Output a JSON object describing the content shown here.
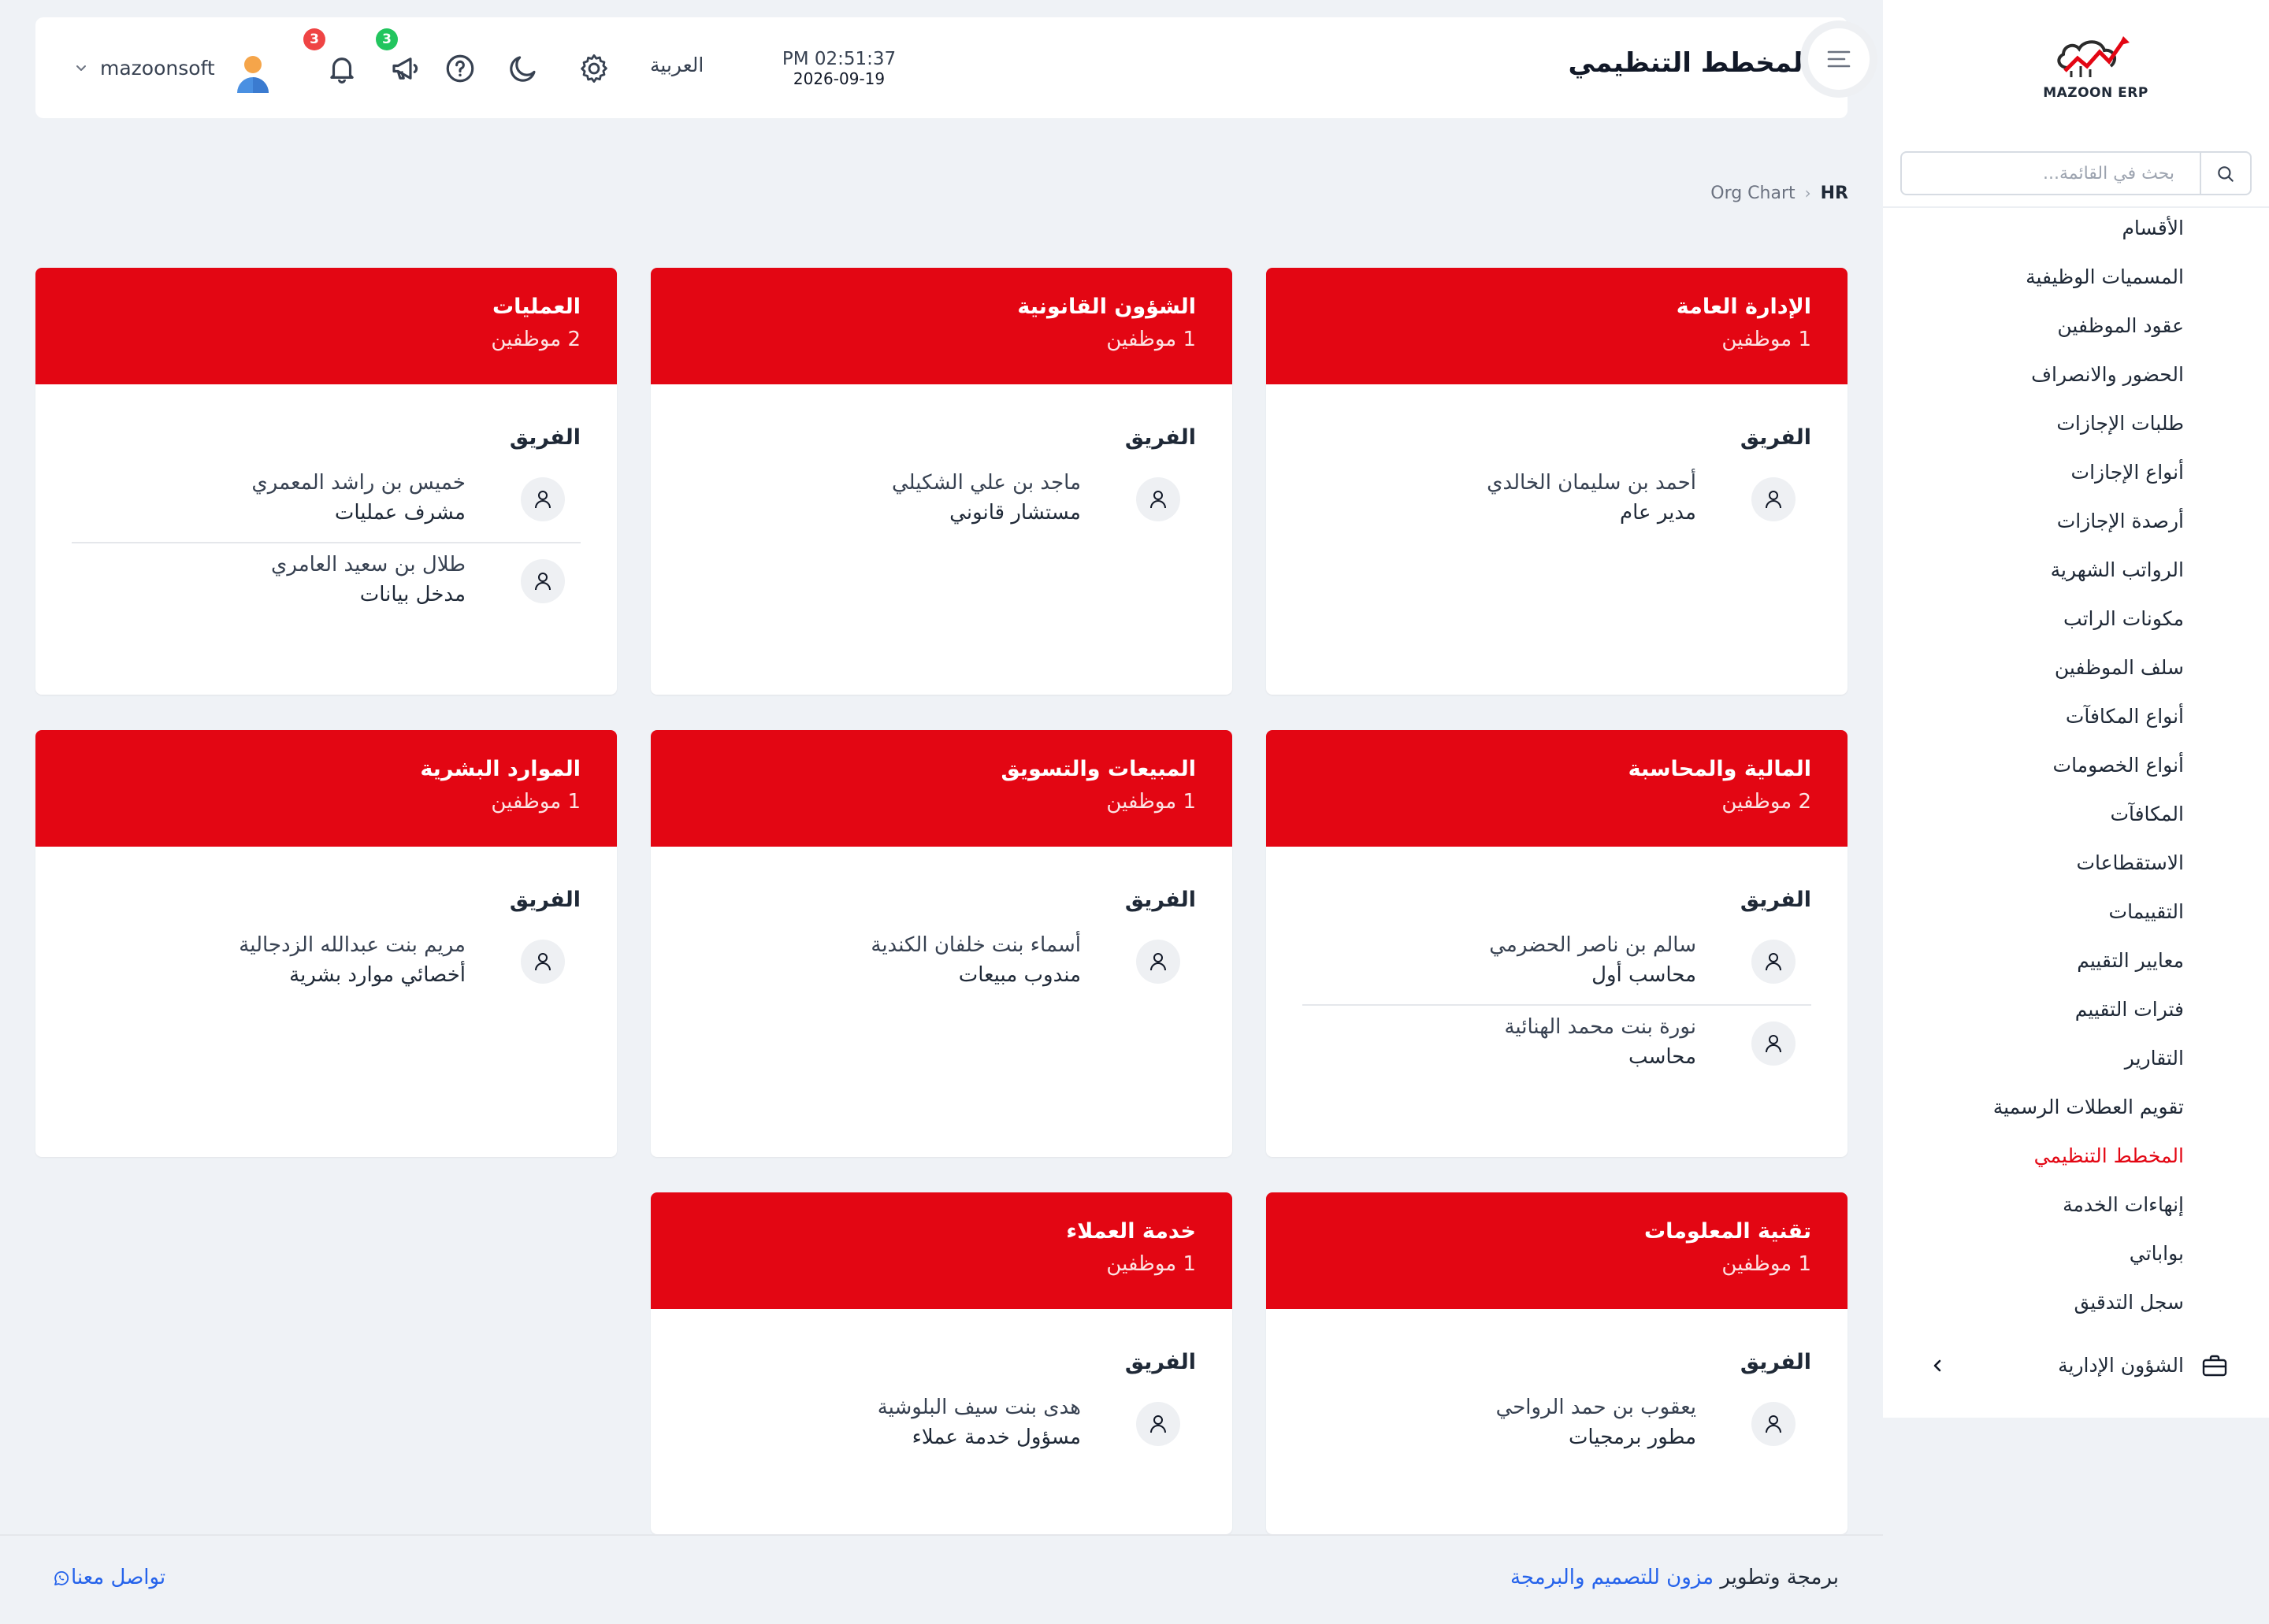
{
  "brand": {
    "logo_text": "MAZOON ERP",
    "accent_color": "#e30613"
  },
  "sidebar": {
    "search_placeholder": "بحث في القائمة...",
    "items": [
      "الأقسام",
      "المسميات الوظيفية",
      "عقود الموظفين",
      "الحضور والانصراف",
      "طلبات الإجازات",
      "أنواع الإجازات",
      "أرصدة الإجازات",
      "الرواتب الشهرية",
      "مكونات الراتب",
      "سلف الموظفين",
      "أنواع المكافآت",
      "أنواع الخصومات",
      "المكافآت",
      "الاستقطاعات",
      "التقييمات",
      "معايير التقييم",
      "فترات التقييم",
      "التقارير",
      "تقويم العطلات الرسمية",
      "المخطط التنظيمي",
      "إنهاءات الخدمة",
      "بواباتي",
      "سجل التدقيق"
    ],
    "active_item": "المخطط التنظيمي",
    "group_label": "الشؤون الإدارية"
  },
  "header": {
    "title": "المخطط التنظيمي",
    "time": "PM 02:51:37",
    "date": "2026-09-19",
    "language": "العربية",
    "notifications_count": "3",
    "announcements_count": "3",
    "username": "mazoonsoft"
  },
  "breadcrumb": {
    "root": "HR",
    "current": "Org Chart"
  },
  "team_label": "الفريق",
  "departments": [
    {
      "name": "الإدارة العامة",
      "count": "1 موظفين",
      "employees": [
        {
          "name": "أحمد بن سليمان الخالدي",
          "role": "مدير عام"
        }
      ]
    },
    {
      "name": "الشؤون القانونية",
      "count": "1 موظفين",
      "employees": [
        {
          "name": "ماجد بن علي الشكيلي",
          "role": "مستشار قانوني"
        }
      ]
    },
    {
      "name": "العمليات",
      "count": "2 موظفين",
      "employees": [
        {
          "name": "خميس بن راشد المعمري",
          "role": "مشرف عمليات"
        },
        {
          "name": "طلال بن سعيد العامري",
          "role": "مدخل بيانات"
        }
      ]
    },
    {
      "name": "المالية والمحاسبة",
      "count": "2 موظفين",
      "employees": [
        {
          "name": "سالم بن ناصر الحضرمي",
          "role": "محاسب أول"
        },
        {
          "name": "نورة بنت محمد الهنائية",
          "role": "محاسب"
        }
      ]
    },
    {
      "name": "المبيعات والتسويق",
      "count": "1 موظفين",
      "employees": [
        {
          "name": "أسماء بنت خلفان الكندية",
          "role": "مندوب مبيعات"
        }
      ]
    },
    {
      "name": "الموارد البشرية",
      "count": "1 موظفين",
      "employees": [
        {
          "name": "مريم بنت عبدالله الزدجالية",
          "role": "أخصائي موارد بشرية"
        }
      ]
    },
    {
      "name": "تقنية المعلومات",
      "count": "1 موظفين",
      "employees": [
        {
          "name": "يعقوب بن حمد الرواحي",
          "role": "مطور برمجيات"
        }
      ]
    },
    {
      "name": "خدمة العملاء",
      "count": "1 موظفين",
      "employees": [
        {
          "name": "هدى بنت سيف البلوشية",
          "role": "مسؤول خدمة عملاء"
        }
      ]
    }
  ],
  "footer": {
    "credit_prefix": "برمجة وتطوير",
    "credit_link": "مزون للتصميم والبرمجة",
    "contact": "تواصل معنا"
  }
}
